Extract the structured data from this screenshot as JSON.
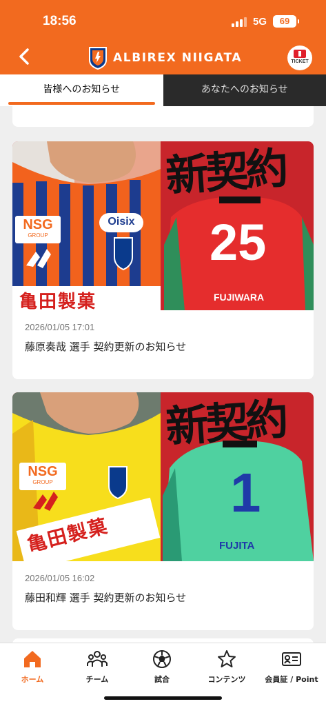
{
  "status_bar": {
    "time": "18:56",
    "network": "5G",
    "battery": "69"
  },
  "header": {
    "brand": "ALBIREX NIIGATA",
    "ticket_label": "TICKET"
  },
  "tabs": [
    {
      "label": "皆様へのお知らせ",
      "active": true
    },
    {
      "label": "あなたへのお知らせ",
      "active": false
    }
  ],
  "news": [
    {
      "date": "2026/01/05 17:01",
      "title": "藤原奏哉 選手 契約更新のお知らせ",
      "image": {
        "headline": "新契約",
        "sponsor": "NSG",
        "sponsor_sub": "GROUP",
        "sponsor2": "Oisix",
        "chest_text": "亀田製菓",
        "number": "25",
        "name": "FUJIWARA",
        "kit_color": "#f2621d",
        "back_color": "#d63030"
      }
    },
    {
      "date": "2026/01/05 16:02",
      "title": "藤田和輝 選手 契約更新のお知らせ",
      "image": {
        "headline": "新契約",
        "sponsor": "NSG",
        "sponsor_sub": "GROUP",
        "chest_text": "亀田製菓",
        "number": "1",
        "name": "FUJITA",
        "kit_color": "#f7de1c",
        "back_color": "#3ec28f"
      }
    }
  ],
  "bottom_nav": [
    {
      "label": "ホーム",
      "icon": "home-icon",
      "active": true
    },
    {
      "label": "チーム",
      "icon": "team-icon",
      "active": false
    },
    {
      "label": "試合",
      "icon": "soccer-ball-icon",
      "active": false
    },
    {
      "label": "コンテンツ",
      "icon": "star-icon",
      "active": false
    },
    {
      "label": "会員証 / Point",
      "icon": "member-card-icon",
      "active": false
    }
  ],
  "colors": {
    "accent": "#f26a1f",
    "tab_inactive_bg": "#2a2a2a",
    "page_bg": "#efefef"
  }
}
